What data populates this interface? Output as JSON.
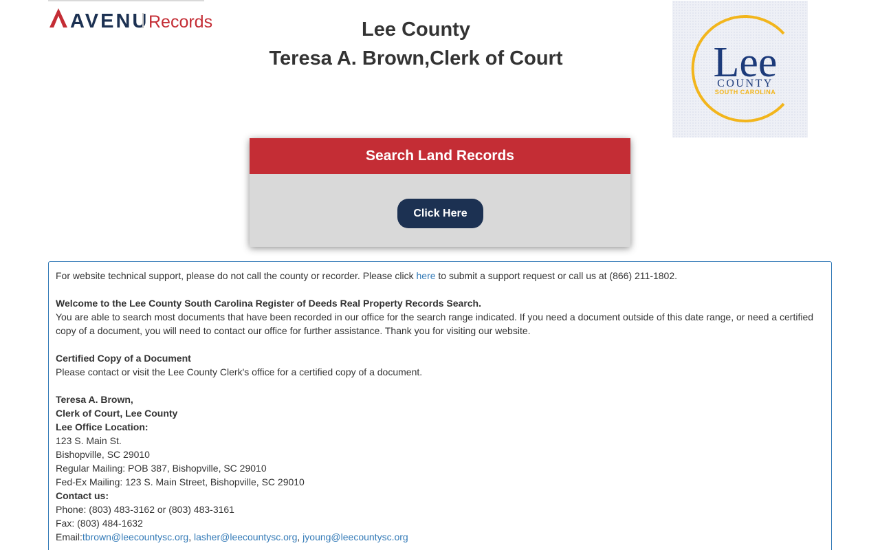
{
  "brand": {
    "logo_primary": "AVENU",
    "logo_secondary": "Records",
    "color_red": "#c42d35",
    "color_navy": "#1c3152"
  },
  "header": {
    "county": "Lee County",
    "clerk": "Teresa A. Brown,Clerk of Court"
  },
  "seal": {
    "word_main": "Lee",
    "word_sub": "COUNTY",
    "word_state": "SOUTH CAROLINA"
  },
  "search": {
    "title": "Search Land Records",
    "button_label": "Click Here"
  },
  "info": {
    "support_before": "For website technical support, please do not call the county or recorder. Please click ",
    "support_link": "here",
    "support_after": " to submit a support request or call us at (866) 211-1802.",
    "welcome_heading": "Welcome to the Lee County South Carolina Register of Deeds Real Property Records Search.",
    "welcome_body": "You are able to search most documents that have been recorded in our office for the search range indicated. If you need a document outside of this date range, or need a certified copy of a document, you will need to contact our office for further assistance. Thank you for visiting our website.",
    "certified_heading": "Certified Copy of a Document",
    "certified_body": "Please contact or visit the Lee County Clerk's office for a certified copy of a document.",
    "name": "Teresa A. Brown,",
    "title": "Clerk of Court, Lee County",
    "office_heading": "Lee Office Location:",
    "address_line1": "123 S. Main St.",
    "address_line2": "Bishopville, SC 29010",
    "regular_mailing": "Regular Mailing: POB 387, Bishopville, SC 29010",
    "fedex_mailing": "Fed-Ex Mailing: 123 S. Main Street, Bishopville, SC 29010",
    "contact_heading": "Contact us:",
    "phone": "Phone: (803) 483-3162 or (803) 483-3161",
    "fax": "Fax: (803) 484-1632",
    "email_label": "Email:",
    "emails": [
      "tbrown@leecountysc.org",
      "lasher@leecountysc.org",
      "jyoung@leecountysc.org"
    ],
    "email_separator": ", "
  }
}
